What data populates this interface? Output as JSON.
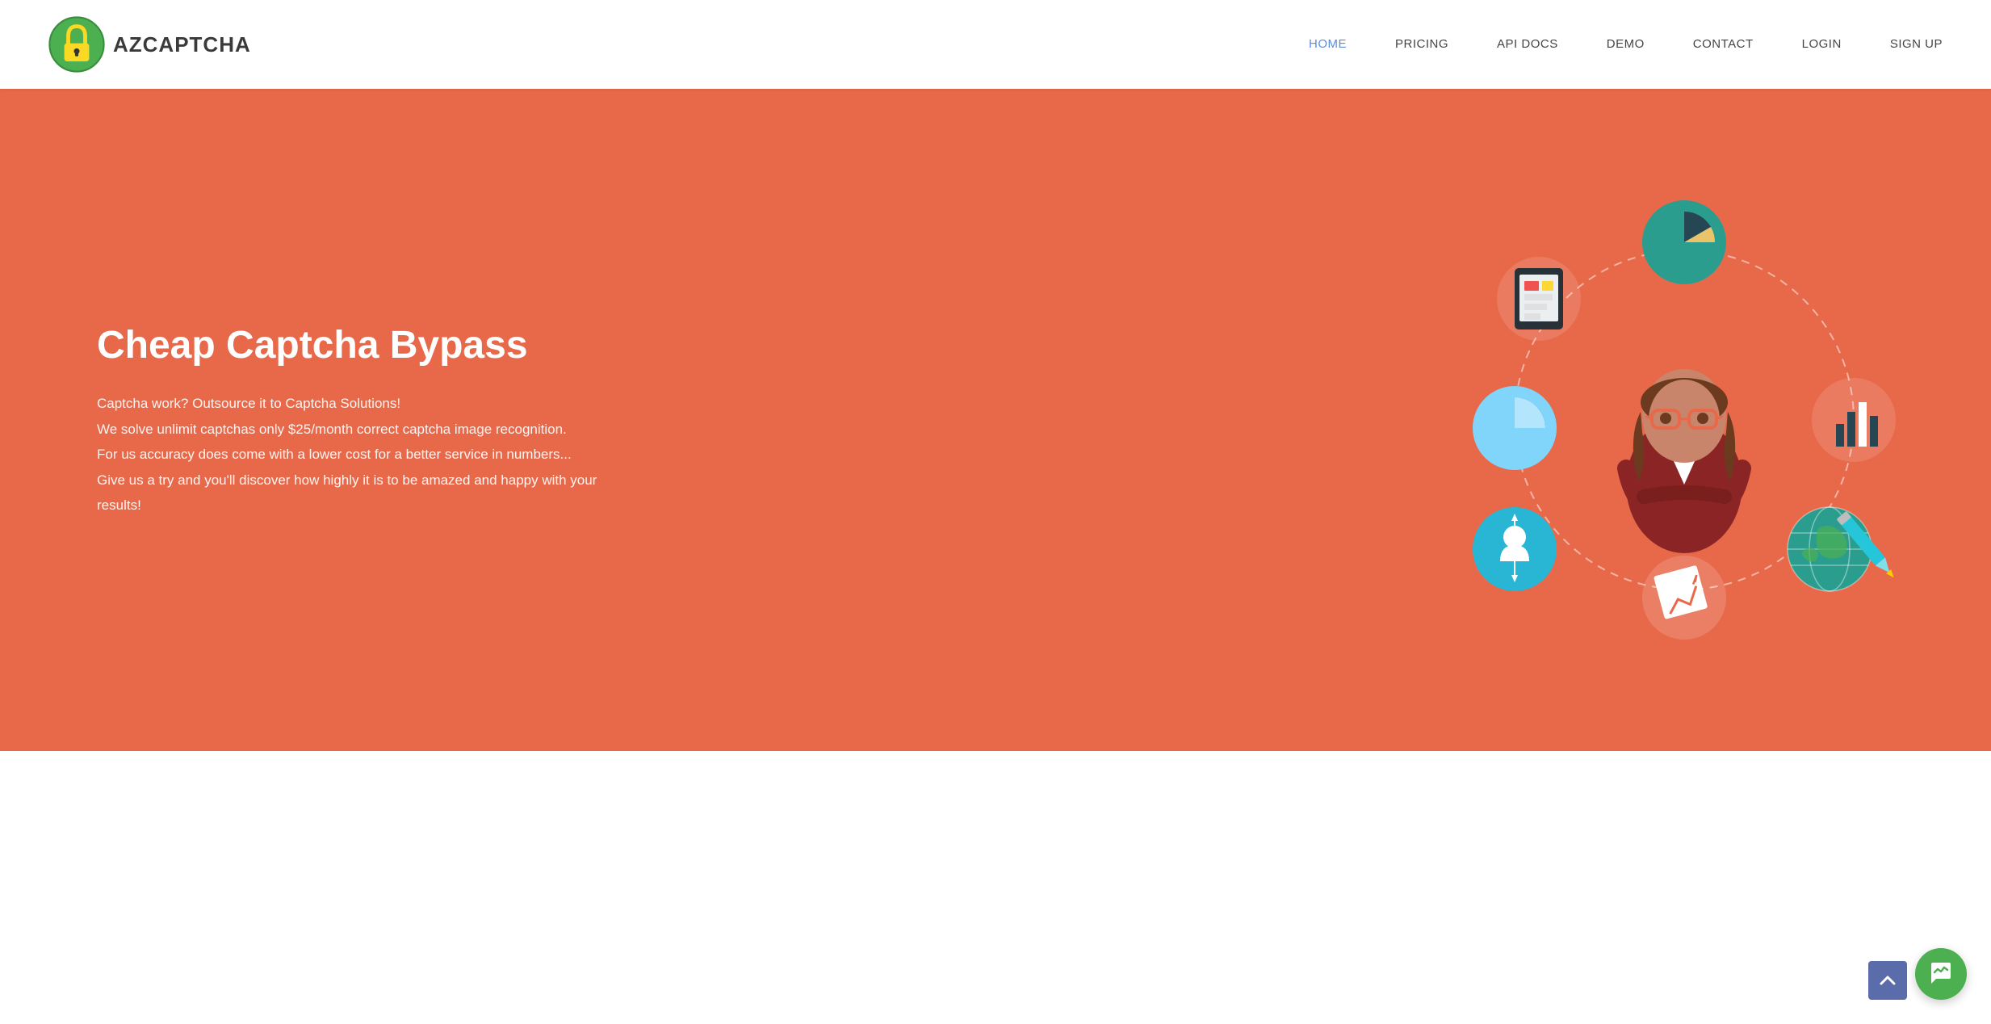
{
  "navbar": {
    "logo_text": "AZCAPTCHA",
    "links": [
      {
        "label": "HOME",
        "active": true,
        "id": "home"
      },
      {
        "label": "PRICING",
        "active": false,
        "id": "pricing"
      },
      {
        "label": "API DOCS",
        "active": false,
        "id": "api-docs"
      },
      {
        "label": "DEMO",
        "active": false,
        "id": "demo"
      },
      {
        "label": "CONTACT",
        "active": false,
        "id": "contact"
      },
      {
        "label": "LOGIN",
        "active": false,
        "id": "login"
      },
      {
        "label": "SIGN UP",
        "active": false,
        "id": "signup"
      }
    ]
  },
  "hero": {
    "title": "Cheap Captcha Bypass",
    "desc_line1": "Captcha work? Outsource it to Captcha Solutions!",
    "desc_line2": "We solve unlimit captchas only $25/month correct captcha image recognition.",
    "desc_line3": "For us accuracy does come with a lower cost for a better service in numbers...",
    "desc_line4": "Give us a try and you'll discover how highly it is to be amazed and happy with your results!",
    "bg_color": "#e8694a"
  },
  "chat": {
    "aria": "Live chat"
  },
  "scroll_top": {
    "aria": "Scroll to top"
  }
}
